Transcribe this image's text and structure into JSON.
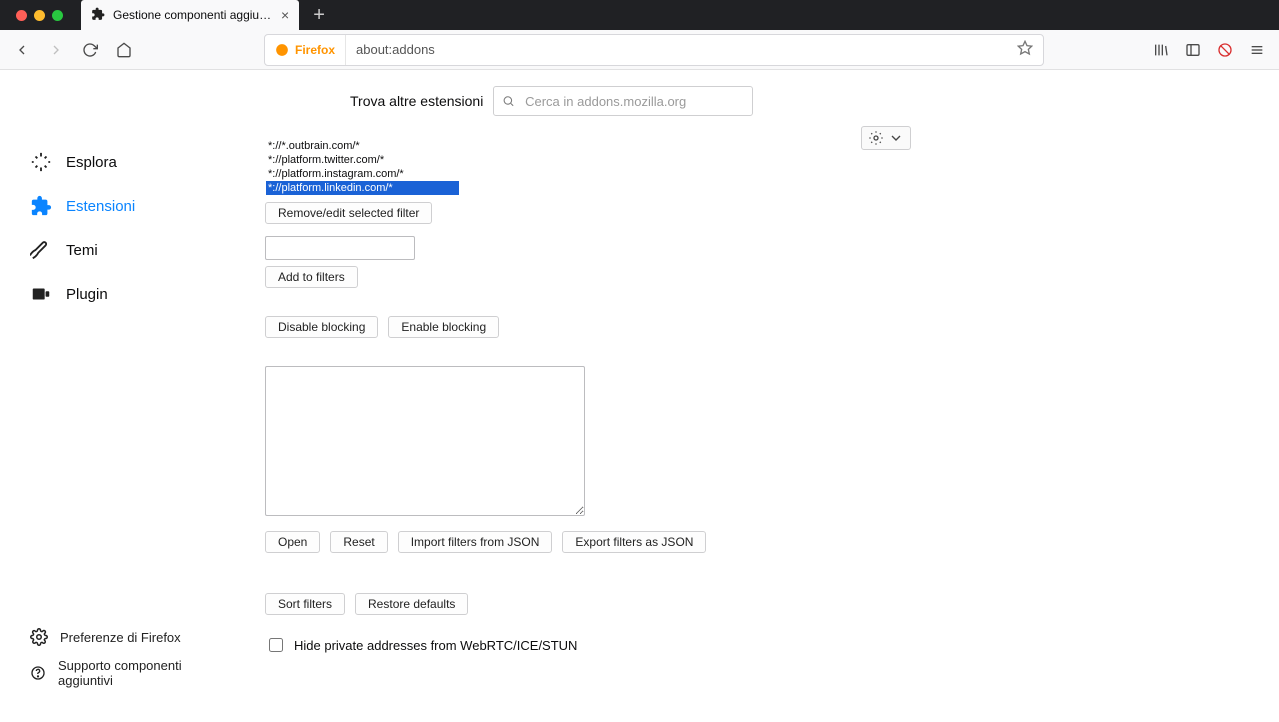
{
  "tab": {
    "title": "Gestione componenti aggiuntivi"
  },
  "urlbar": {
    "identity": "Firefox",
    "address": "about:addons"
  },
  "search": {
    "label": "Trova altre estensioni",
    "placeholder": "Cerca in addons.mozilla.org"
  },
  "sidebar": {
    "items": [
      {
        "label": "Esplora"
      },
      {
        "label": "Estensioni"
      },
      {
        "label": "Temi"
      },
      {
        "label": "Plugin"
      }
    ],
    "bottom": {
      "prefs": "Preferenze di Firefox",
      "support": "Supporto componenti aggiuntivi"
    }
  },
  "filters": {
    "items": [
      "*://*.outbrain.com/*",
      "*://platform.twitter.com/*",
      "*://platform.instagram.com/*",
      "*://platform.linkedin.com/*"
    ],
    "selected_index": 3
  },
  "buttons": {
    "remove_edit": "Remove/edit selected filter",
    "add": "Add to filters",
    "disable": "Disable blocking",
    "enable": "Enable blocking",
    "open": "Open",
    "reset": "Reset",
    "import": "Import filters from JSON",
    "export": "Export filters as JSON",
    "sort": "Sort filters",
    "restore": "Restore defaults"
  },
  "checkbox": {
    "hide_webrtc": "Hide private addresses from WebRTC/ICE/STUN"
  }
}
